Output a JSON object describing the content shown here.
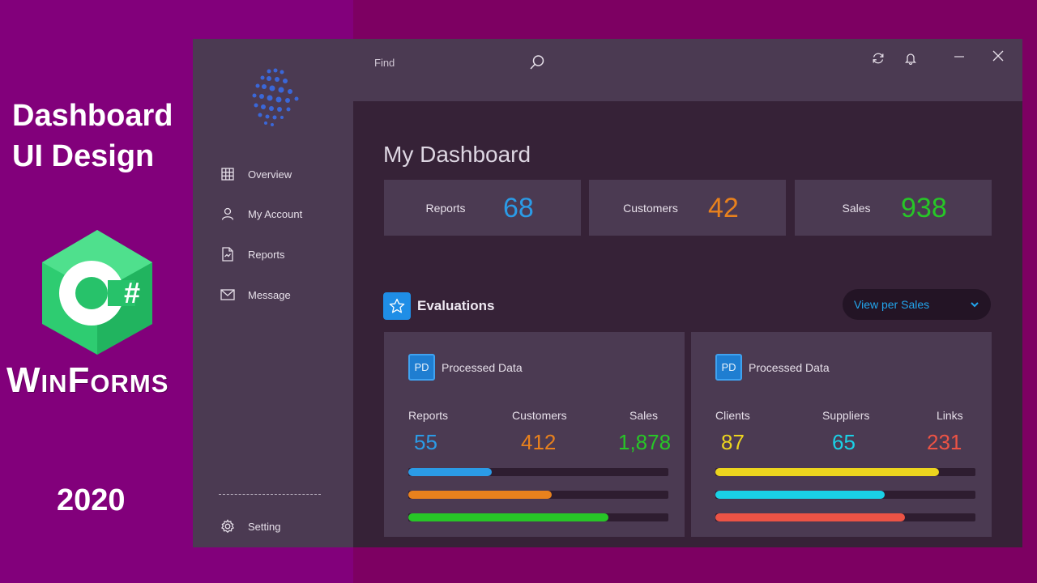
{
  "promo": {
    "title_line1": "Dashboard",
    "title_line2": "UI Design",
    "logo_mark": "C#",
    "framework": "WinForms",
    "year": "2020"
  },
  "sidebar": {
    "items": [
      {
        "label": "Overview",
        "icon": "grid-icon"
      },
      {
        "label": "My Account",
        "icon": "user-icon"
      },
      {
        "label": "Reports",
        "icon": "report-file-icon"
      },
      {
        "label": "Message",
        "icon": "mail-icon"
      }
    ],
    "divider": "----------------------------",
    "settings_label": "Setting"
  },
  "topbar": {
    "search_placeholder": "Find",
    "icons": [
      "search-icon",
      "refresh-icon",
      "bell-icon",
      "minimize-icon",
      "close-icon"
    ]
  },
  "dashboard": {
    "title": "My Dashboard",
    "stats": [
      {
        "label": "Reports",
        "value": "68",
        "color": "#2b9be6"
      },
      {
        "label": "Customers",
        "value": "42",
        "color": "#e8811d"
      },
      {
        "label": "Sales",
        "value": "938",
        "color": "#27c627"
      }
    ]
  },
  "evaluations": {
    "title": "Evaluations",
    "view_selected": "View per Sales",
    "panels": [
      {
        "badge": "PD",
        "title": "Processed Data",
        "metrics": [
          {
            "label": "Reports",
            "value": "55",
            "color": "#2b9be6",
            "progress": 0.32
          },
          {
            "label": "Customers",
            "value": "412",
            "color": "#e8811d",
            "progress": 0.55
          },
          {
            "label": "Sales",
            "value": "1,878",
            "color": "#27c627",
            "progress": 0.77
          }
        ]
      },
      {
        "badge": "PD",
        "title": "Processed Data",
        "metrics": [
          {
            "label": "Clients",
            "value": "87",
            "color": "#ecd51e",
            "progress": 0.86
          },
          {
            "label": "Suppliers",
            "value": "65",
            "color": "#1ad1e6",
            "progress": 0.65
          },
          {
            "label": "Links",
            "value": "231",
            "color": "#ec5345",
            "progress": 0.73
          }
        ]
      }
    ]
  },
  "colors": {
    "window_bg": "#362237",
    "panel_bg": "#4b3a52",
    "accent_blue": "#1f8ee6"
  }
}
